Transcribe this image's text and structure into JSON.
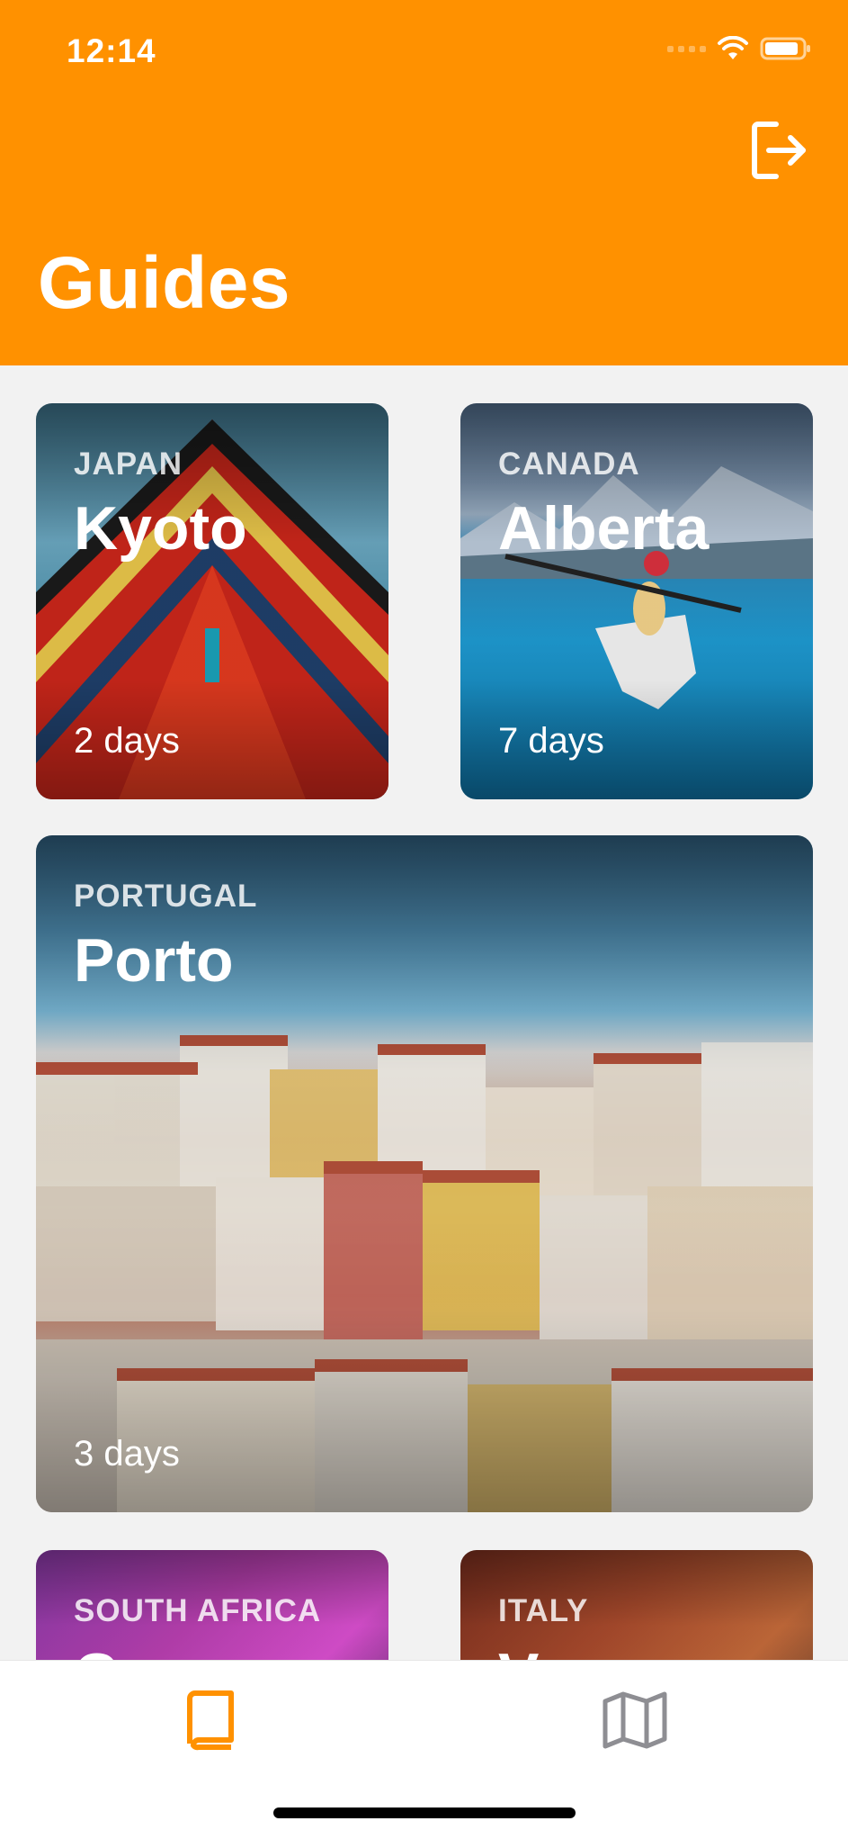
{
  "status_bar": {
    "time": "12:14"
  },
  "header": {
    "title": "Guides",
    "logout_icon": "logout-icon"
  },
  "colors": {
    "accent": "#ff9100",
    "tab_inactive": "#8e8e93"
  },
  "guides": [
    {
      "country": "JAPAN",
      "city": "Kyoto",
      "days": "2 days"
    },
    {
      "country": "CANADA",
      "city": "Alberta",
      "days": "7 days"
    },
    {
      "country": "PORTUGAL",
      "city": "Porto",
      "days": "3 days"
    },
    {
      "country": "SOUTH AFRICA",
      "city": "C",
      "days": ""
    },
    {
      "country": "ITALY",
      "city": "V",
      "days": ""
    }
  ],
  "tabbar": {
    "items": [
      {
        "icon": "book-icon",
        "selected": true
      },
      {
        "icon": "map-icon",
        "selected": false
      }
    ]
  }
}
